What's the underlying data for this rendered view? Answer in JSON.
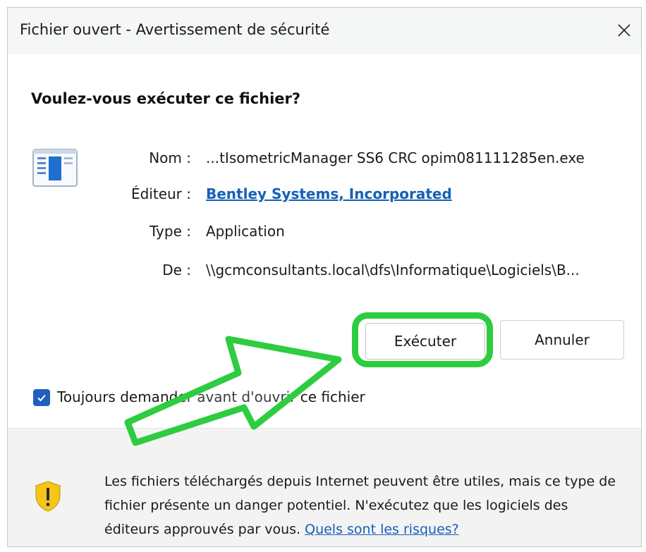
{
  "window": {
    "title": "Fichier ouvert - Avertissement de sécurité",
    "close_symbol": "✕"
  },
  "question": "Voulez-vous exécuter ce fichier?",
  "file_info": {
    "name_label": "Nom :",
    "name_value": "...tIsometricManager SS6 CRC opim081111285en.exe",
    "publisher_label": "Éditeur :",
    "publisher_value": "Bentley Systems, Incorporated",
    "type_label": "Type :",
    "type_value": "Application",
    "from_label": "De :",
    "from_value": "\\\\gcmconsultants.local\\dfs\\Informatique\\Logiciels\\B..."
  },
  "buttons": {
    "run_label": "Exécuter",
    "cancel_label": "Annuler"
  },
  "checkbox": {
    "label": "Toujours demander avant d'ouvrir ce fichier",
    "checked": true
  },
  "warning": {
    "text": "Les fichiers téléchargés depuis Internet peuvent être utiles, mais ce type de fichier présente un danger potentiel. N'exécutez que les logiciels des éditeurs approuvés par vous. ",
    "link_text": "Quels sont les risques?"
  },
  "colors": {
    "accent": "#1f5fbf",
    "link": "#1560b8",
    "highlight": "#2ecc40",
    "shield": "#f5c518"
  },
  "icons": {
    "close": "close-icon",
    "app": "application-icon",
    "checkbox": "checkmark-icon",
    "shield": "warning-shield-icon",
    "arrow": "arrow-annotation"
  }
}
